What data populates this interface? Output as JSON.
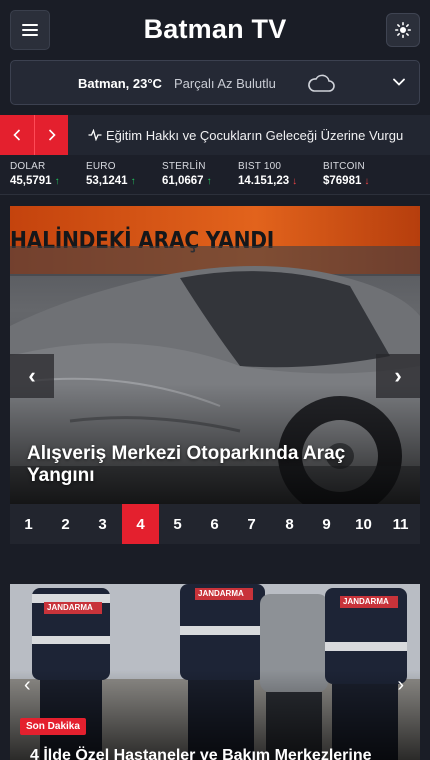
{
  "header": {
    "title": "Batman TV",
    "menu_icon": "hamburger-icon",
    "theme_icon": "sun-icon"
  },
  "weather": {
    "city": "Batman, 23°C",
    "description": "Parçalı Az Bulutlu",
    "icon": "cloud-icon"
  },
  "ticker": {
    "headline": "Eğitim Hakkı ve Çocukların Geleceği Üzerine Vurgu",
    "accent": "#e4202e"
  },
  "market": [
    {
      "name": "DOLAR",
      "value": "45,5791",
      "trend": "up"
    },
    {
      "name": "EURO",
      "value": "53,1241",
      "trend": "up"
    },
    {
      "name": "STERLİN",
      "value": "61,0667",
      "trend": "up"
    },
    {
      "name": "BIST 100",
      "value": "14.151,23",
      "trend": "down"
    },
    {
      "name": "BITCOIN",
      "value": "$76981",
      "trend": "down"
    }
  ],
  "slider1": {
    "banner": "HALİNDEKİ ARAÇ YANDI",
    "title": "Alışveriş Merkezi Otoparkında Araç Yangını",
    "prev": "‹",
    "next": "›",
    "pages": [
      "1",
      "2",
      "3",
      "4",
      "5",
      "6",
      "7",
      "8",
      "9",
      "10",
      "11"
    ],
    "active_page": "4"
  },
  "slider2": {
    "badge": "Son Dakika",
    "title": "4 İlde Özel Hastaneler ve Bakım Merkezlerine",
    "vest_label": "JANDARMA",
    "prev": "‹",
    "next": "›"
  }
}
